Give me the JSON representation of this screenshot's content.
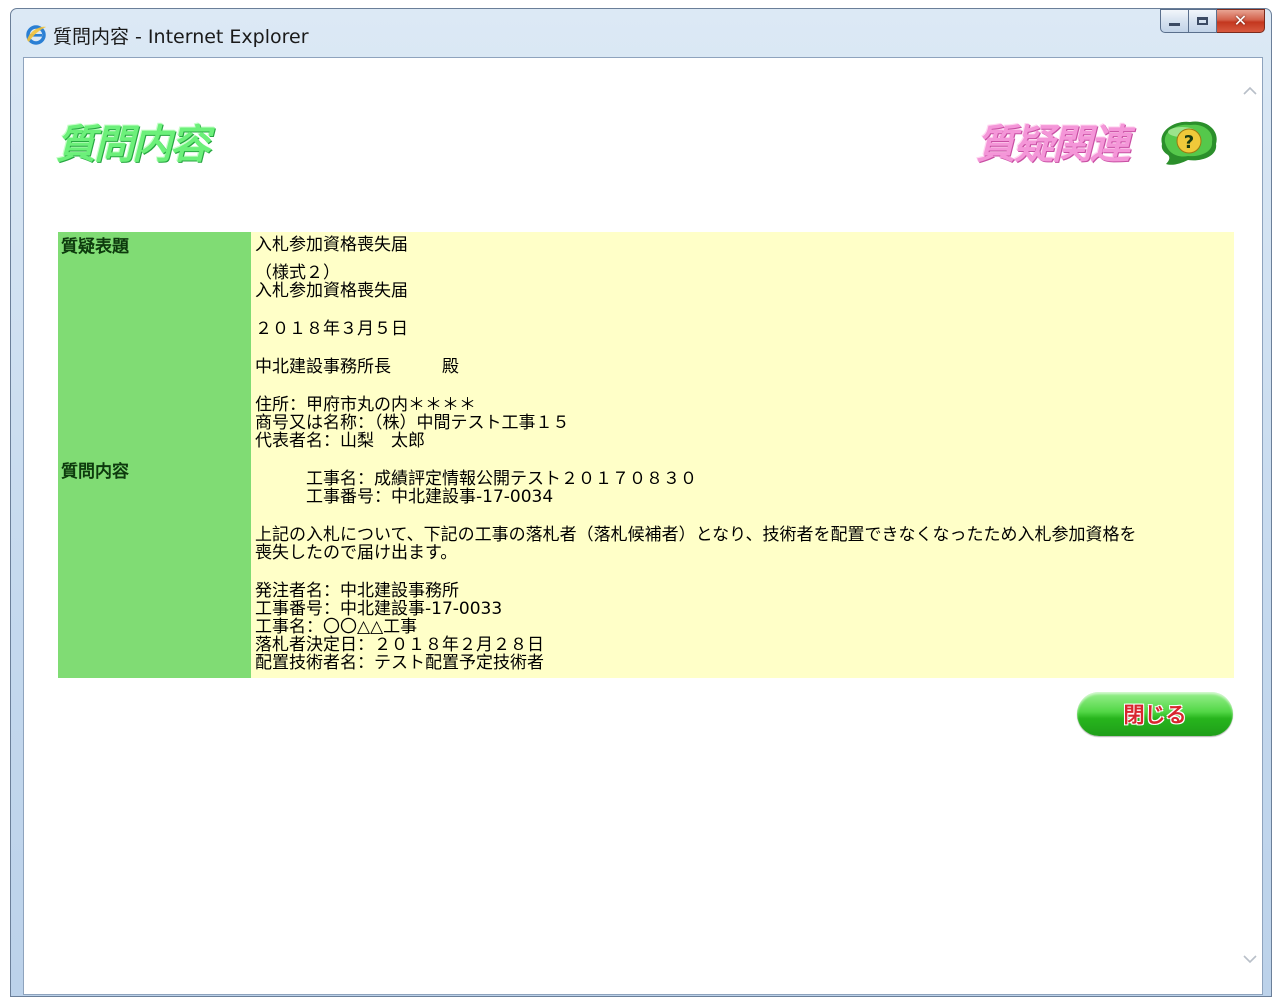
{
  "window": {
    "title": "質問内容 - Internet Explorer"
  },
  "page": {
    "title": "質問内容",
    "related_title": "質疑関連"
  },
  "question": {
    "subject_label": "質疑表題",
    "subject_value": "入札参加資格喪失届",
    "content_label": "質問内容",
    "content_lines": [
      "（様式２）",
      "入札参加資格喪失届",
      "",
      "２０１８年３月５日",
      "",
      "中北建設事務所長　　　殿",
      "",
      "住所：甲府市丸の内＊＊＊＊",
      "商号又は名称：（株）中間テスト工事１５",
      "代表者名：山梨　太郎",
      "",
      "　　　工事名：成績評定情報公開テスト２０１７０８３０",
      "　　　工事番号：中北建設事-17-0034",
      "",
      "上記の入札について、下記の工事の落札者（落札候補者）となり、技術者を配置できなくなったため入札参加資格を",
      "喪失したので届け出ます。",
      "",
      "発注者名：中北建設事務所",
      "工事番号：中北建設事-17-0033",
      "工事名：〇〇△△工事",
      "落札者決定日：２０１８年２月２８日",
      "配置技術者名：テスト配置予定技術者"
    ]
  },
  "actions": {
    "close_label": "閉じる"
  },
  "colors": {
    "header_green": "#80dc74",
    "value_yellow": "#ffffc8",
    "title_green": "#6cf07a",
    "title_pink": "#f496d8",
    "button_text_red": "#d8262e"
  }
}
